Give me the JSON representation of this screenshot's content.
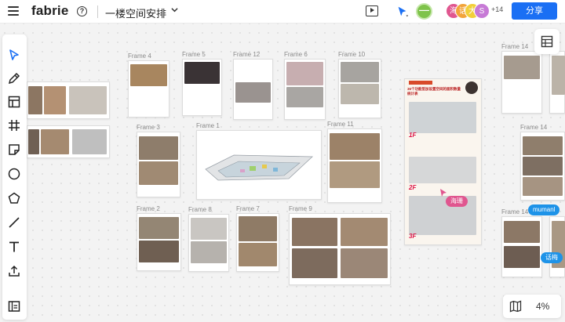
{
  "topbar": {
    "logo": "fabrie",
    "doc_title": "一楼空间安排",
    "me_initial": "一",
    "avatars": [
      {
        "text": "海",
        "color": "#e0568f"
      },
      {
        "text": "话",
        "color": "#f2a43a"
      },
      {
        "text": "大",
        "color": "#f2cf3a"
      },
      {
        "text": "S",
        "color": "#c77ad6"
      }
    ],
    "more_count": "+14",
    "share_label": "分享"
  },
  "toolbar": {
    "tools": [
      "select-icon",
      "pen-icon",
      "layout-icon",
      "frame-icon",
      "sticky-note-icon",
      "circle-icon",
      "polygon-icon",
      "line-icon",
      "text-icon",
      "upload-icon",
      "bottom-panel-icon"
    ]
  },
  "frames": {
    "f4": "Frame 4",
    "f5": "Frame 5",
    "f12": "Frame 12",
    "f6": "Frame 6",
    "f10": "Frame 10",
    "f3": "Frame 3",
    "f1": "Frame 1",
    "f11": "Frame 11",
    "f2": "Frame 2",
    "f8": "Frame 8",
    "f7": "Frame 7",
    "f9": "Frame 9",
    "r1": "Frame 14",
    "r2": "Frame 14",
    "r3": "Frame 14"
  },
  "poster": {
    "title": "36个功能型加设置空间的面积数量统计表",
    "floors": [
      "1F",
      "2F",
      "3F"
    ]
  },
  "cursor_tags": [
    {
      "name": "海珊",
      "color": "#e0568f"
    },
    {
      "name": "mumanl",
      "color": "#1e93e8"
    },
    {
      "name": "话梅",
      "color": "#1e93e8"
    }
  ],
  "bottom_right": {
    "zoom": "4%"
  },
  "colors": {
    "accent": "#1a6ff4",
    "photo_warm": "#b79a7c",
    "photo_cool": "#9aa0a6",
    "photo_dark": "#5b4d43"
  }
}
